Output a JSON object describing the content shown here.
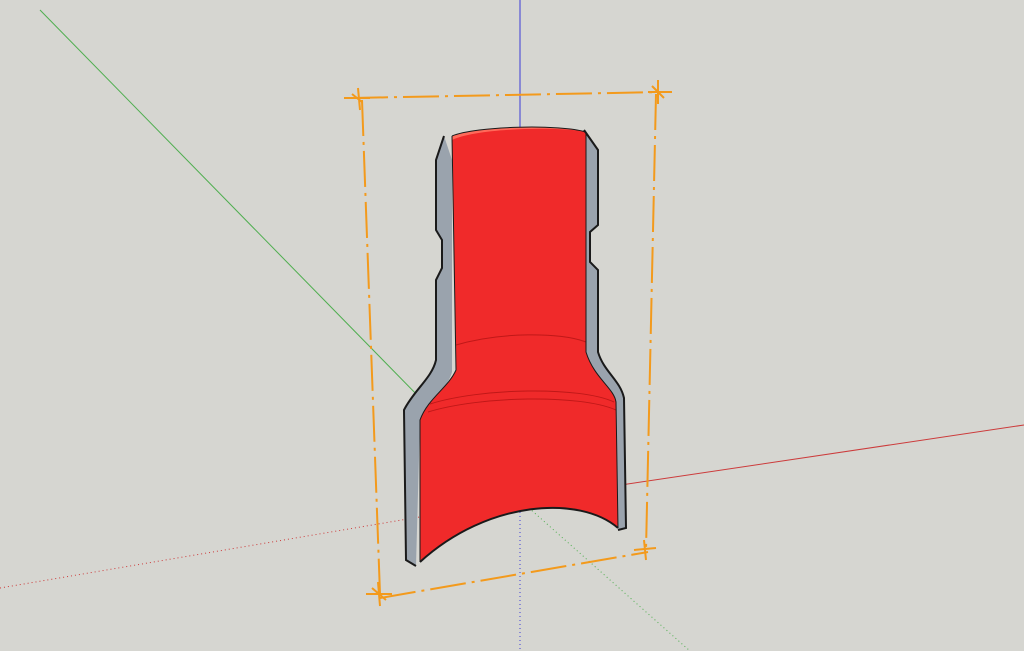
{
  "app": {
    "type": "3d-modeling-viewport"
  },
  "viewport": {
    "background_color": "#d6d6d1",
    "axes": {
      "red_axis_color": "#cc3b3b",
      "green_axis_color": "#4fae4f",
      "blue_axis_color": "#3c3cd8"
    }
  },
  "model": {
    "name": "red-pipe-adapter",
    "face_color": "#f02a2a",
    "back_face_color": "#9aa3ad",
    "edge_color": "#1a1a1a",
    "selected": true
  },
  "selection": {
    "bounding_box_color": "#f39a1c",
    "grips": 4
  }
}
